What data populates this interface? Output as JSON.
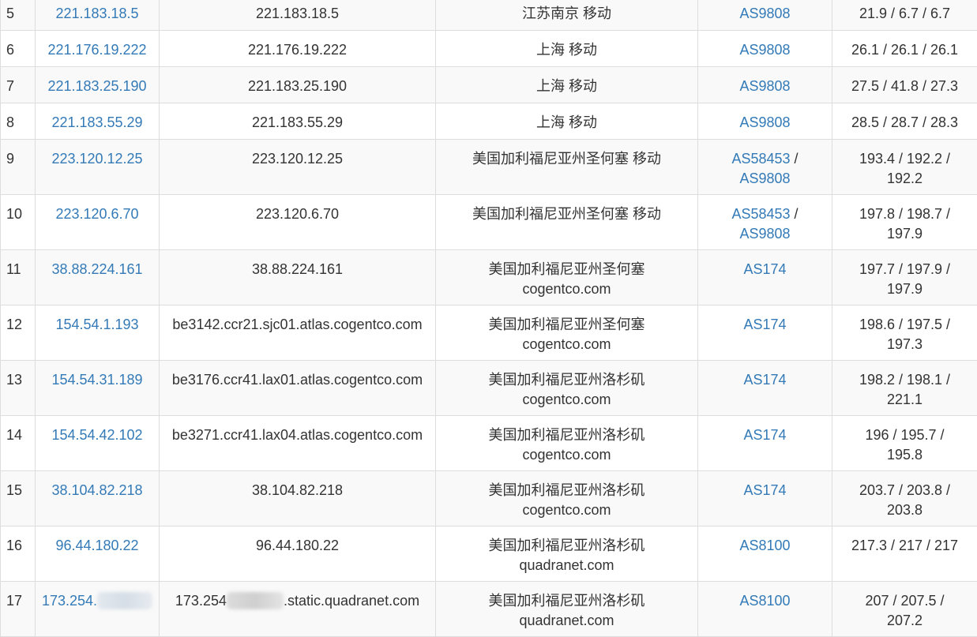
{
  "rows": [
    {
      "hop": "5",
      "ip": "221.183.18.5",
      "host": "221.183.18.5",
      "location": [
        "江苏南京 移动"
      ],
      "asn": [
        "AS9808"
      ],
      "latency": "21.9 / 6.7 / 6.7"
    },
    {
      "hop": "6",
      "ip": "221.176.19.222",
      "host": "221.176.19.222",
      "location": [
        "上海 移动"
      ],
      "asn": [
        "AS9808"
      ],
      "latency": "26.1 / 26.1 / 26.1"
    },
    {
      "hop": "7",
      "ip": "221.183.25.190",
      "host": "221.183.25.190",
      "location": [
        "上海 移动"
      ],
      "asn": [
        "AS9808"
      ],
      "latency": "27.5 / 41.8 / 27.3"
    },
    {
      "hop": "8",
      "ip": "221.183.55.29",
      "host": "221.183.55.29",
      "location": [
        "上海 移动"
      ],
      "asn": [
        "AS9808"
      ],
      "latency": "28.5 / 28.7 / 28.3"
    },
    {
      "hop": "9",
      "ip": "223.120.12.25",
      "host": "223.120.12.25",
      "location": [
        "美国加利福尼亚州圣何塞 移动"
      ],
      "asn": [
        "AS58453",
        "AS9808"
      ],
      "latency": "193.4 / 192.2 / 192.2"
    },
    {
      "hop": "10",
      "ip": "223.120.6.70",
      "host": "223.120.6.70",
      "location": [
        "美国加利福尼亚州圣何塞 移动"
      ],
      "asn": [
        "AS58453",
        "AS9808"
      ],
      "latency": "197.8 / 198.7 / 197.9"
    },
    {
      "hop": "11",
      "ip": "38.88.224.161",
      "host": "38.88.224.161",
      "location": [
        "美国加利福尼亚州圣何塞",
        "cogentco.com"
      ],
      "asn": [
        "AS174"
      ],
      "latency": "197.7 / 197.9 / 197.9"
    },
    {
      "hop": "12",
      "ip": "154.54.1.193",
      "host": "be3142.ccr21.sjc01.atlas.cogentco.com",
      "location": [
        "美国加利福尼亚州圣何塞",
        "cogentco.com"
      ],
      "asn": [
        "AS174"
      ],
      "latency": "198.6 / 197.5 / 197.3"
    },
    {
      "hop": "13",
      "ip": "154.54.31.189",
      "host": "be3176.ccr41.lax01.atlas.cogentco.com",
      "location": [
        "美国加利福尼亚州洛杉矶",
        "cogentco.com"
      ],
      "asn": [
        "AS174"
      ],
      "latency": "198.2 / 198.1 / 221.1"
    },
    {
      "hop": "14",
      "ip": "154.54.42.102",
      "host": "be3271.ccr41.lax04.atlas.cogentco.com",
      "location": [
        "美国加利福尼亚州洛杉矶",
        "cogentco.com"
      ],
      "asn": [
        "AS174"
      ],
      "latency": "196 / 195.7 / 195.8"
    },
    {
      "hop": "15",
      "ip": "38.104.82.218",
      "host": "38.104.82.218",
      "location": [
        "美国加利福尼亚州洛杉矶",
        "cogentco.com"
      ],
      "asn": [
        "AS174"
      ],
      "latency": "203.7 / 203.8 / 203.8"
    },
    {
      "hop": "16",
      "ip": "96.44.180.22",
      "host": "96.44.180.22",
      "location": [
        "美国加利福尼亚州洛杉矶",
        "quadranet.com"
      ],
      "asn": [
        "AS8100"
      ],
      "latency": "217.3 / 217 / 217"
    },
    {
      "hop": "17",
      "ip": "173.254.",
      "host_prefix": "173.254",
      "host_suffix": ".static.quadranet.com",
      "location": [
        "美国加利福尼亚州洛杉矶",
        "quadranet.com"
      ],
      "asn": [
        "AS8100"
      ],
      "latency": "207 / 207.5 / 207.2",
      "redacted": true
    }
  ],
  "colors": {
    "link": "#337ab7",
    "text": "#333333",
    "border": "#dddddd",
    "stripe": "#f9f9f9"
  }
}
